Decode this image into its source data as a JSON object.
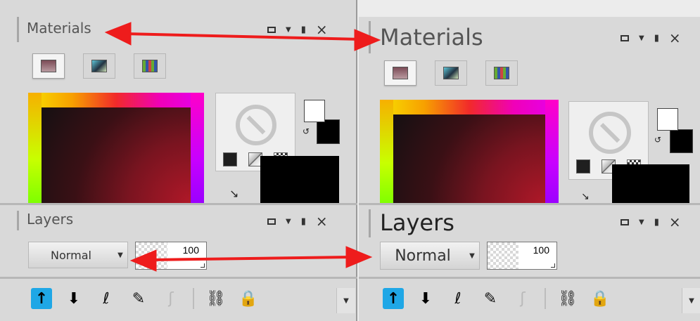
{
  "left": {
    "materials": {
      "title": "Materials"
    },
    "layers": {
      "title": "Layers",
      "blend_mode": "Normal",
      "opacity": "100"
    }
  },
  "right": {
    "materials": {
      "title": "Materials"
    },
    "layers": {
      "title": "Layers",
      "blend_mode": "Normal",
      "opacity": "100"
    }
  },
  "icons": {
    "window_controls": [
      "restore-icon",
      "dropdown-caret-icon",
      "pin-icon",
      "close-icon"
    ],
    "material_tabs": [
      "frame-tab-icon",
      "gradient-tab-icon",
      "swatches-tab-icon"
    ],
    "layer_tools": [
      "move-layer-up-icon",
      "move-layer-down-icon",
      "visibility-icon",
      "layer-properties-icon",
      "mask-icon",
      "link-icon",
      "lock-icon",
      "more-dropdown-icon"
    ]
  },
  "colors": {
    "annotation_arrow": "#ee1c1c",
    "panel_bg": "#d9d9d9"
  }
}
